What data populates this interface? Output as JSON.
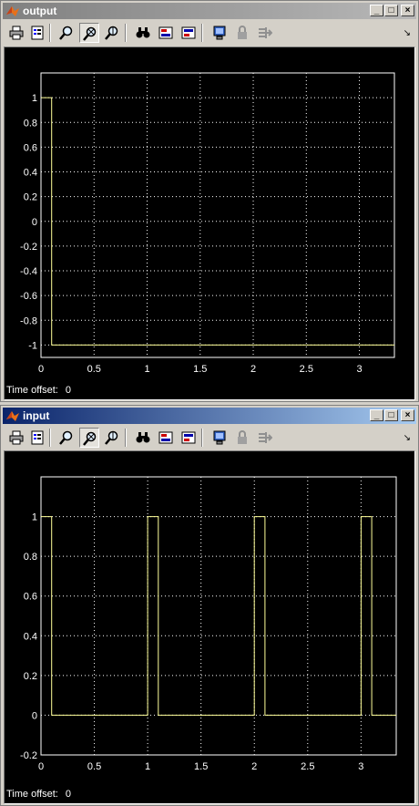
{
  "windows": [
    {
      "id": "output",
      "title": "output",
      "active": false,
      "time_offset_label": "Time offset:",
      "time_offset_value": "0",
      "controls": {
        "minimize": "_",
        "maximize": "□",
        "close": "×"
      },
      "toolbar": [
        "print-icon",
        "parameters-icon",
        "zoom-icon",
        "zoom-x-icon",
        "zoom-y-icon",
        "autoscale-icon",
        "save-axes-icon",
        "restore-axes-icon",
        "floating-scope-icon",
        "lock-icon",
        "signal-selection-icon"
      ],
      "chart_data": {
        "type": "line",
        "xlim": [
          0,
          3.33
        ],
        "ylim": [
          -1.1,
          1.2
        ],
        "xticks": [
          0,
          0.5,
          1,
          1.5,
          2,
          2.5,
          3
        ],
        "xtick_labels": [
          "0",
          "0.5",
          "1",
          "1.5",
          "2",
          "2.5",
          "3"
        ],
        "yticks": [
          1,
          0.8,
          0.6,
          0.4,
          0.2,
          0,
          -0.2,
          -0.4,
          -0.6,
          -0.8,
          -1
        ],
        "ytick_labels": [
          "1",
          "0.8",
          "0.6",
          "0.4",
          "0.2",
          "0",
          "-0.2",
          "-0.4",
          "-0.6",
          "-0.8",
          "-1"
        ],
        "grid": true,
        "color": "#ffff99",
        "series": [
          {
            "x": [
              0,
              0.1,
              0.1,
              3.33
            ],
            "y": [
              1,
              1,
              -1,
              -1
            ]
          }
        ]
      }
    },
    {
      "id": "input",
      "title": "input",
      "active": true,
      "time_offset_label": "Time offset:",
      "time_offset_value": "0",
      "controls": {
        "minimize": "_",
        "maximize": "□",
        "close": "×"
      },
      "toolbar": [
        "print-icon",
        "parameters-icon",
        "zoom-icon",
        "zoom-x-icon",
        "zoom-y-icon",
        "autoscale-icon",
        "save-axes-icon",
        "restore-axes-icon",
        "floating-scope-icon",
        "lock-icon",
        "signal-selection-icon"
      ],
      "chart_data": {
        "type": "line",
        "xlim": [
          0,
          3.33
        ],
        "ylim": [
          -0.2,
          1.2
        ],
        "xticks": [
          0,
          0.5,
          1,
          1.5,
          2,
          2.5,
          3
        ],
        "xtick_labels": [
          "0",
          "0.5",
          "1",
          "1.5",
          "2",
          "2.5",
          "3"
        ],
        "yticks": [
          1,
          0.8,
          0.6,
          0.4,
          0.2,
          0,
          -0.2
        ],
        "ytick_labels": [
          "1",
          "0.8",
          "0.6",
          "0.4",
          "0.2",
          "0",
          "-0.2"
        ],
        "grid": true,
        "color": "#ffff99",
        "series": [
          {
            "x": [
              0,
              0.1,
              0.1,
              1.0,
              1.0,
              1.1,
              1.1,
              2.0,
              2.0,
              2.1,
              2.1,
              3.0,
              3.0,
              3.1,
              3.1,
              3.33
            ],
            "y": [
              1,
              1,
              0,
              0,
              1,
              1,
              0,
              0,
              1,
              1,
              0,
              0,
              1,
              1,
              0,
              0
            ]
          }
        ]
      }
    }
  ]
}
